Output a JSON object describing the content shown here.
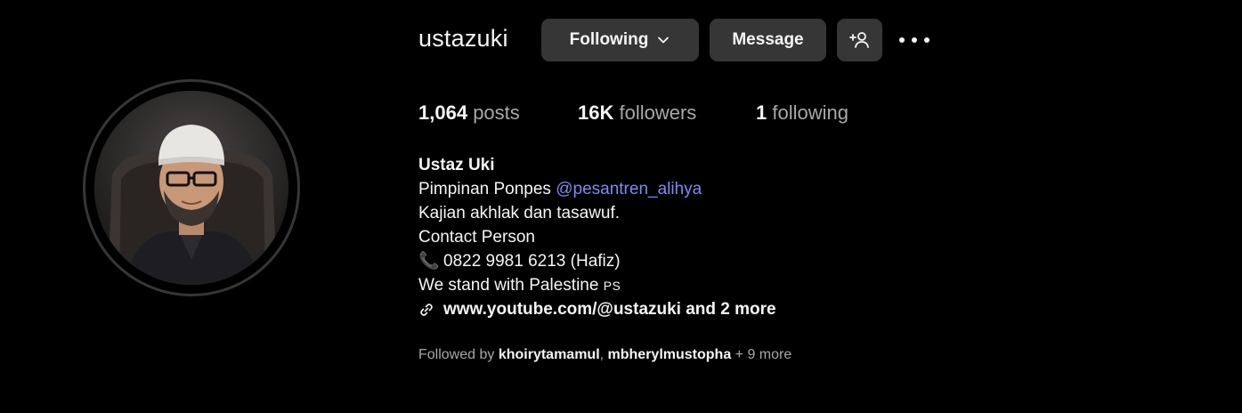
{
  "header": {
    "username": "ustazuki",
    "following_label": "Following",
    "message_label": "Message"
  },
  "stats": {
    "posts_count": "1,064",
    "posts_label": "posts",
    "followers_count": "16K",
    "followers_label": "followers",
    "following_count": "1",
    "following_label": "following"
  },
  "bio": {
    "name": "Ustaz Uki",
    "line1_prefix": "Pimpinan Ponpes ",
    "line1_mention": "@pesantren_alihya",
    "line2": "Kajian akhlak dan tasawuf.",
    "line3": "Contact Person",
    "phone_emoji": "📞",
    "line4": "0822 9981 6213 (Hafiz)",
    "line5": "We stand with Palestine",
    "line5_flag": "PS",
    "link": "www.youtube.com/@ustazuki and 2 more"
  },
  "followed_by": {
    "prefix": "Followed by ",
    "user1": "khoirytamamul",
    "separator": ", ",
    "user2": "mbherylmustopha",
    "suffix": " + 9 more"
  },
  "colors": {
    "background": "#000000",
    "button_bg": "#363636",
    "mention": "#7a8cf2",
    "muted": "#a8a8a8",
    "text": "#f5f5f5"
  },
  "icons": {
    "following_chevron": "chevron-down-icon",
    "add_user": "add-user-icon",
    "more": "more-horizontal-icon",
    "link": "link-icon",
    "phone": "telephone-icon"
  }
}
